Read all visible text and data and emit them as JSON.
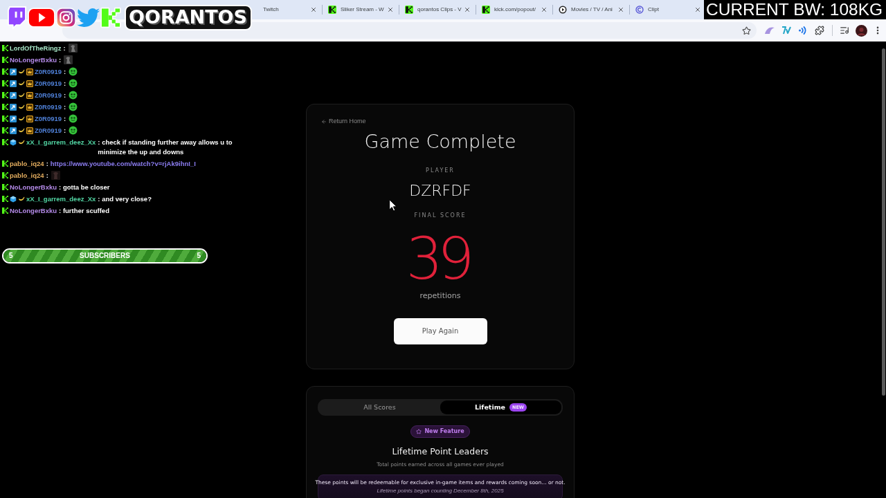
{
  "browser": {
    "tabs": [
      {
        "title": "Twitch",
        "selected": false
      },
      {
        "title": "Sliker Stream - W",
        "favicon": {
          "kind": "kick"
        },
        "selected": false
      },
      {
        "title": "qorantos Clips - V",
        "favicon": {
          "kind": "kick"
        },
        "selected": false
      },
      {
        "title": "kick.com/popout/",
        "favicon": {
          "kind": "kick"
        },
        "selected": false
      },
      {
        "title": "Movies / TV / Ani",
        "favicon": {
          "kind": "play"
        },
        "selected": false
      },
      {
        "title": "Clipt",
        "favicon": {
          "kind": "clipt"
        },
        "selected": false
      }
    ]
  },
  "overlay": {
    "brand": "QORANTOS",
    "bodyweight": "CURRENT BW: 108KG"
  },
  "chat": {
    "messages": [
      {
        "badges": [
          {
            "kind": "kick"
          }
        ],
        "user": "LordOfTheRingz",
        "color": "#a8e8c8",
        "kind": "emote",
        "text": ":",
        "emote": {
          "kind": "figure"
        }
      },
      {
        "badges": [
          {
            "kind": "kick"
          }
        ],
        "user": "NoLongerBxku",
        "color": "#b48ae8",
        "kind": "emote",
        "text": ":",
        "emote": {
          "kind": "figure"
        }
      },
      {
        "badges": [
          {
            "kind": "kick"
          },
          {
            "kind": "sub"
          },
          {
            "kind": "banana"
          },
          {
            "kind": "crown"
          }
        ],
        "user": "Z0R0919",
        "color": "#4f80d8",
        "kind": "emote",
        "text": ":",
        "emote": {
          "kind": "blob"
        }
      },
      {
        "badges": [
          {
            "kind": "kick"
          },
          {
            "kind": "sub"
          },
          {
            "kind": "banana"
          },
          {
            "kind": "crown"
          }
        ],
        "user": "Z0R0919",
        "color": "#4f80d8",
        "kind": "emote",
        "text": ":",
        "emote": {
          "kind": "blob"
        }
      },
      {
        "badges": [
          {
            "kind": "kick"
          },
          {
            "kind": "sub"
          },
          {
            "kind": "banana"
          },
          {
            "kind": "crown"
          }
        ],
        "user": "Z0R0919",
        "color": "#4f80d8",
        "kind": "emote",
        "text": ":",
        "emote": {
          "kind": "blob"
        }
      },
      {
        "badges": [
          {
            "kind": "kick"
          },
          {
            "kind": "sub"
          },
          {
            "kind": "banana"
          },
          {
            "kind": "crown"
          }
        ],
        "user": "Z0R0919",
        "color": "#4f80d8",
        "kind": "emote",
        "text": ":",
        "emote": {
          "kind": "blob"
        }
      },
      {
        "badges": [
          {
            "kind": "kick"
          },
          {
            "kind": "sub"
          },
          {
            "kind": "banana"
          },
          {
            "kind": "crown"
          }
        ],
        "user": "Z0R0919",
        "color": "#4f80d8",
        "kind": "emote",
        "text": ":",
        "emote": {
          "kind": "blob"
        }
      },
      {
        "badges": [
          {
            "kind": "kick"
          },
          {
            "kind": "sub"
          },
          {
            "kind": "banana"
          },
          {
            "kind": "crown"
          }
        ],
        "user": "Z0R0919",
        "color": "#4f80d8",
        "kind": "emote",
        "text": ":",
        "emote": {
          "kind": "blob"
        }
      },
      {
        "badges": [
          {
            "kind": "kick"
          },
          {
            "kind": "cube"
          },
          {
            "kind": "banana"
          }
        ],
        "user": "xX_I_garrem_deez_Xx",
        "color": "#52d6a4",
        "kind": "text",
        "text": ": check if standing further away allows u to minimize the up and downs"
      },
      {
        "badges": [
          {
            "kind": "kick"
          }
        ],
        "user": "pablo_iq24",
        "color": "#e2ac5e",
        "kind": "link",
        "text": ":",
        "link": "https://www.youtube.com/watch?v=rjAk9ihnI_I"
      },
      {
        "badges": [
          {
            "kind": "kick"
          }
        ],
        "user": "pablo_iq24",
        "color": "#e2ac5e",
        "kind": "emote",
        "text": ":",
        "emote": {
          "kind": "shadow"
        }
      },
      {
        "badges": [
          {
            "kind": "kick"
          }
        ],
        "user": "NoLongerBxku",
        "color": "#b48ae8",
        "kind": "text",
        "text": ": gotta be closer"
      },
      {
        "badges": [
          {
            "kind": "kick"
          },
          {
            "kind": "cube"
          },
          {
            "kind": "banana"
          }
        ],
        "user": "xX_I_garrem_deez_Xx",
        "color": "#52d6a4",
        "kind": "text",
        "text": ": and very close?"
      },
      {
        "badges": [
          {
            "kind": "kick"
          }
        ],
        "user": "NoLongerBxku",
        "color": "#b48ae8",
        "kind": "text",
        "text": ": further scuffed"
      }
    ],
    "goal": {
      "current": "5",
      "label": "SUBSCRIBERS",
      "target": "5",
      "level": 1
    }
  },
  "result": {
    "back_link": "Return Home",
    "title": "Game Complete",
    "player_label": "PLAYER",
    "player": "DZRFDF",
    "score_label": "FINAL SCORE",
    "score": "39",
    "unit": "repetitions",
    "button": "Play Again"
  },
  "leaderboard": {
    "tabs": [
      {
        "label": "All Scores",
        "selected": false
      },
      {
        "label": "Lifetime",
        "selected": true,
        "badge": "NEW"
      }
    ],
    "feature_badge": "New Feature",
    "title": "Lifetime Point Leaders",
    "subtitle": "Total points earned across all games ever played",
    "notice": "These points will be redeemable for exclusive in-game items and rewards coming soon... or not.",
    "notice_note": "Lifetime points began counting December 8th, 2025"
  }
}
